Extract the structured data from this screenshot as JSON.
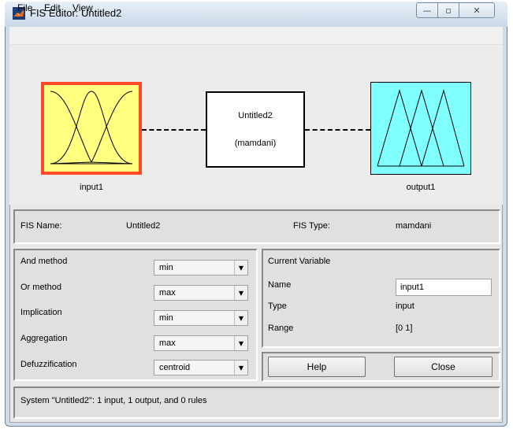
{
  "window": {
    "title": "FIS Editor: Untitled2",
    "minimize_glyph": "—",
    "maximize_glyph": "▫",
    "close_glyph": "✕",
    "app_icon": "matlab-logo-icon"
  },
  "menu": {
    "items": [
      "File",
      "Edit",
      "View"
    ]
  },
  "diagram": {
    "input": {
      "label": "input1",
      "icon": "gaussian-membership-icon",
      "fill": "#ffff80",
      "border": "#ff4a2a"
    },
    "system": {
      "name": "Untitled2",
      "type": "(mamdani)"
    },
    "output": {
      "label": "output1",
      "icon": "triangular-membership-icon",
      "fill": "#80ffff"
    }
  },
  "fis_info": {
    "name_label": "FIS Name:",
    "name_value": "Untitled2",
    "type_label": "FIS Type:",
    "type_value": "mamdani"
  },
  "methods": [
    {
      "label": "And method",
      "value": "min"
    },
    {
      "label": "Or method",
      "value": "max"
    },
    {
      "label": "Implication",
      "value": "min"
    },
    {
      "label": "Aggregation",
      "value": "max"
    },
    {
      "label": "Defuzzification",
      "value": "centroid"
    }
  ],
  "current_variable": {
    "heading": "Current Variable",
    "name_label": "Name",
    "name_value": "input1",
    "type_label": "Type",
    "type_value": "input",
    "range_label": "Range",
    "range_value": "[0 1]"
  },
  "buttons": {
    "help": "Help",
    "close": "Close"
  },
  "status": {
    "text": "System \"Untitled2\": 1 input, 1 output, and 0 rules"
  }
}
